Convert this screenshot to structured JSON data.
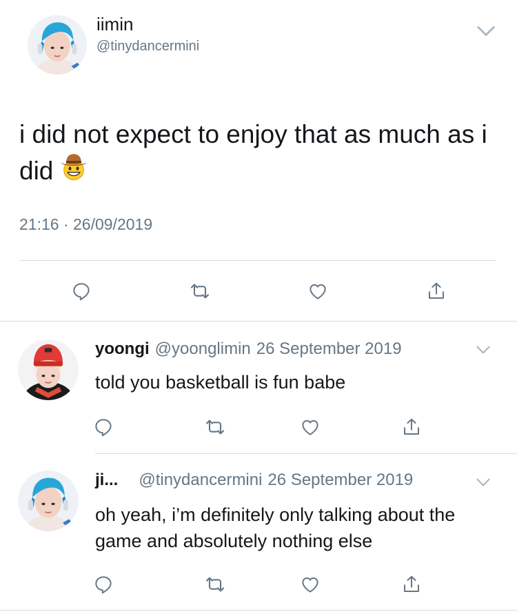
{
  "main_tweet": {
    "display_name": "iimin",
    "handle": "@tinydancermini",
    "text": "i did not expect to enjoy that as much as i did",
    "emoji": "cowboy-hat-face",
    "timestamp": "21:16 · 26/09/2019"
  },
  "replies": [
    {
      "display_name": "yoongi",
      "handle": "@yoonglimin",
      "date": "26 September 2019",
      "text": "told you basketball is fun babe"
    },
    {
      "display_name": "ji...",
      "handle": "@tinydancermini",
      "date": "26 September 2019",
      "text": "oh yeah, i’m definitely only talking about the game and absolutely nothing else"
    }
  ],
  "icons": [
    "reply-icon",
    "retweet-icon",
    "like-icon",
    "share-icon",
    "chevron-down-icon"
  ],
  "colors": {
    "text": "#14171a",
    "secondary": "#657786",
    "divider": "#d6dbe0"
  }
}
